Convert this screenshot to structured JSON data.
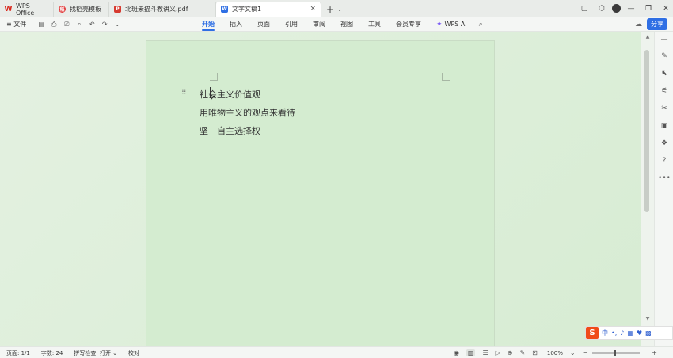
{
  "tabs": [
    {
      "label": "WPS Office",
      "icon": "wps-logo-icon"
    },
    {
      "label": "找稻壳模板",
      "icon": "docer-icon"
    },
    {
      "label": "北斑素描斗教讲义.pdf",
      "icon": "pdf-icon"
    },
    {
      "label": "文字文稿1",
      "icon": "word-doc-icon",
      "close": "×"
    }
  ],
  "tab_add": "+",
  "toolbar": {
    "file_menu": "≡ 文件",
    "ribbon_tabs": [
      "开始",
      "插入",
      "页面",
      "引用",
      "审阅",
      "视图",
      "工具",
      "会员专享"
    ],
    "wps_ai": "WPS AI",
    "share": "分享"
  },
  "document": {
    "lines": [
      "社会主义价值观",
      "用唯物主义的观点来看待",
      "坚　自主选择权"
    ]
  },
  "statusbar": {
    "page": "页面: 1/1",
    "words": "字数: 24",
    "spellcheck": "拼写检查: 打开 ⌄",
    "proofread": "校对",
    "zoom": "100%"
  },
  "ime": {
    "mode": "中"
  },
  "colors": {
    "accent": "#2f6fe4",
    "page_bg": "#d4ecd0",
    "ime_red": "#f04b1a"
  }
}
